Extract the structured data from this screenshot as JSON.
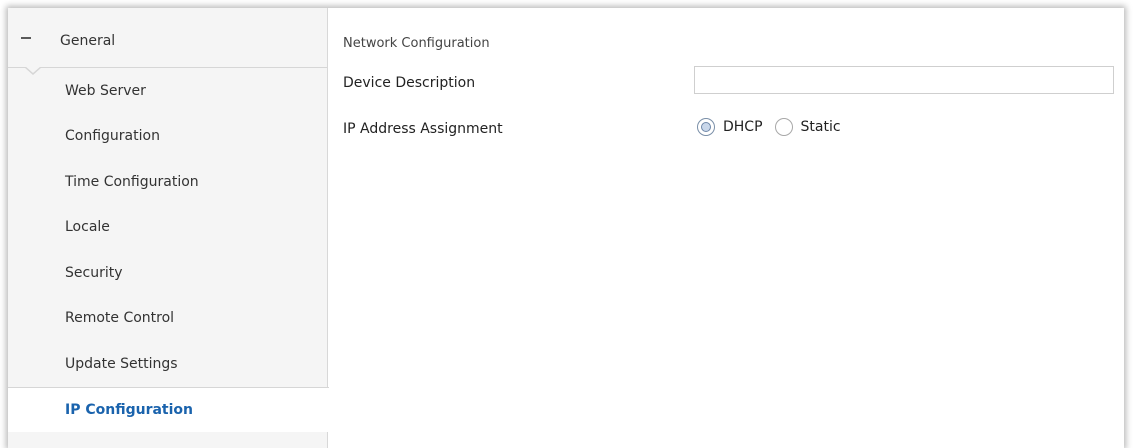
{
  "sidebar": {
    "group_label": "General",
    "items": [
      {
        "label": "Web Server"
      },
      {
        "label": "Configuration"
      },
      {
        "label": "Time Configuration"
      },
      {
        "label": "Locale"
      },
      {
        "label": "Security"
      },
      {
        "label": "Remote Control"
      },
      {
        "label": "Update Settings"
      },
      {
        "label": "IP Configuration",
        "active": true
      }
    ]
  },
  "main": {
    "section_title": "Network Configuration",
    "device_description": {
      "label": "Device Description",
      "value": ""
    },
    "ip_assignment": {
      "label": "IP Address Assignment",
      "options": [
        {
          "label": "DHCP",
          "selected": true
        },
        {
          "label": "Static",
          "selected": false
        }
      ]
    }
  },
  "colors": {
    "active_item": "#1a63ad",
    "sidebar_bg": "#f5f5f5"
  },
  "icons": {
    "group_toggle": "minus-icon"
  }
}
